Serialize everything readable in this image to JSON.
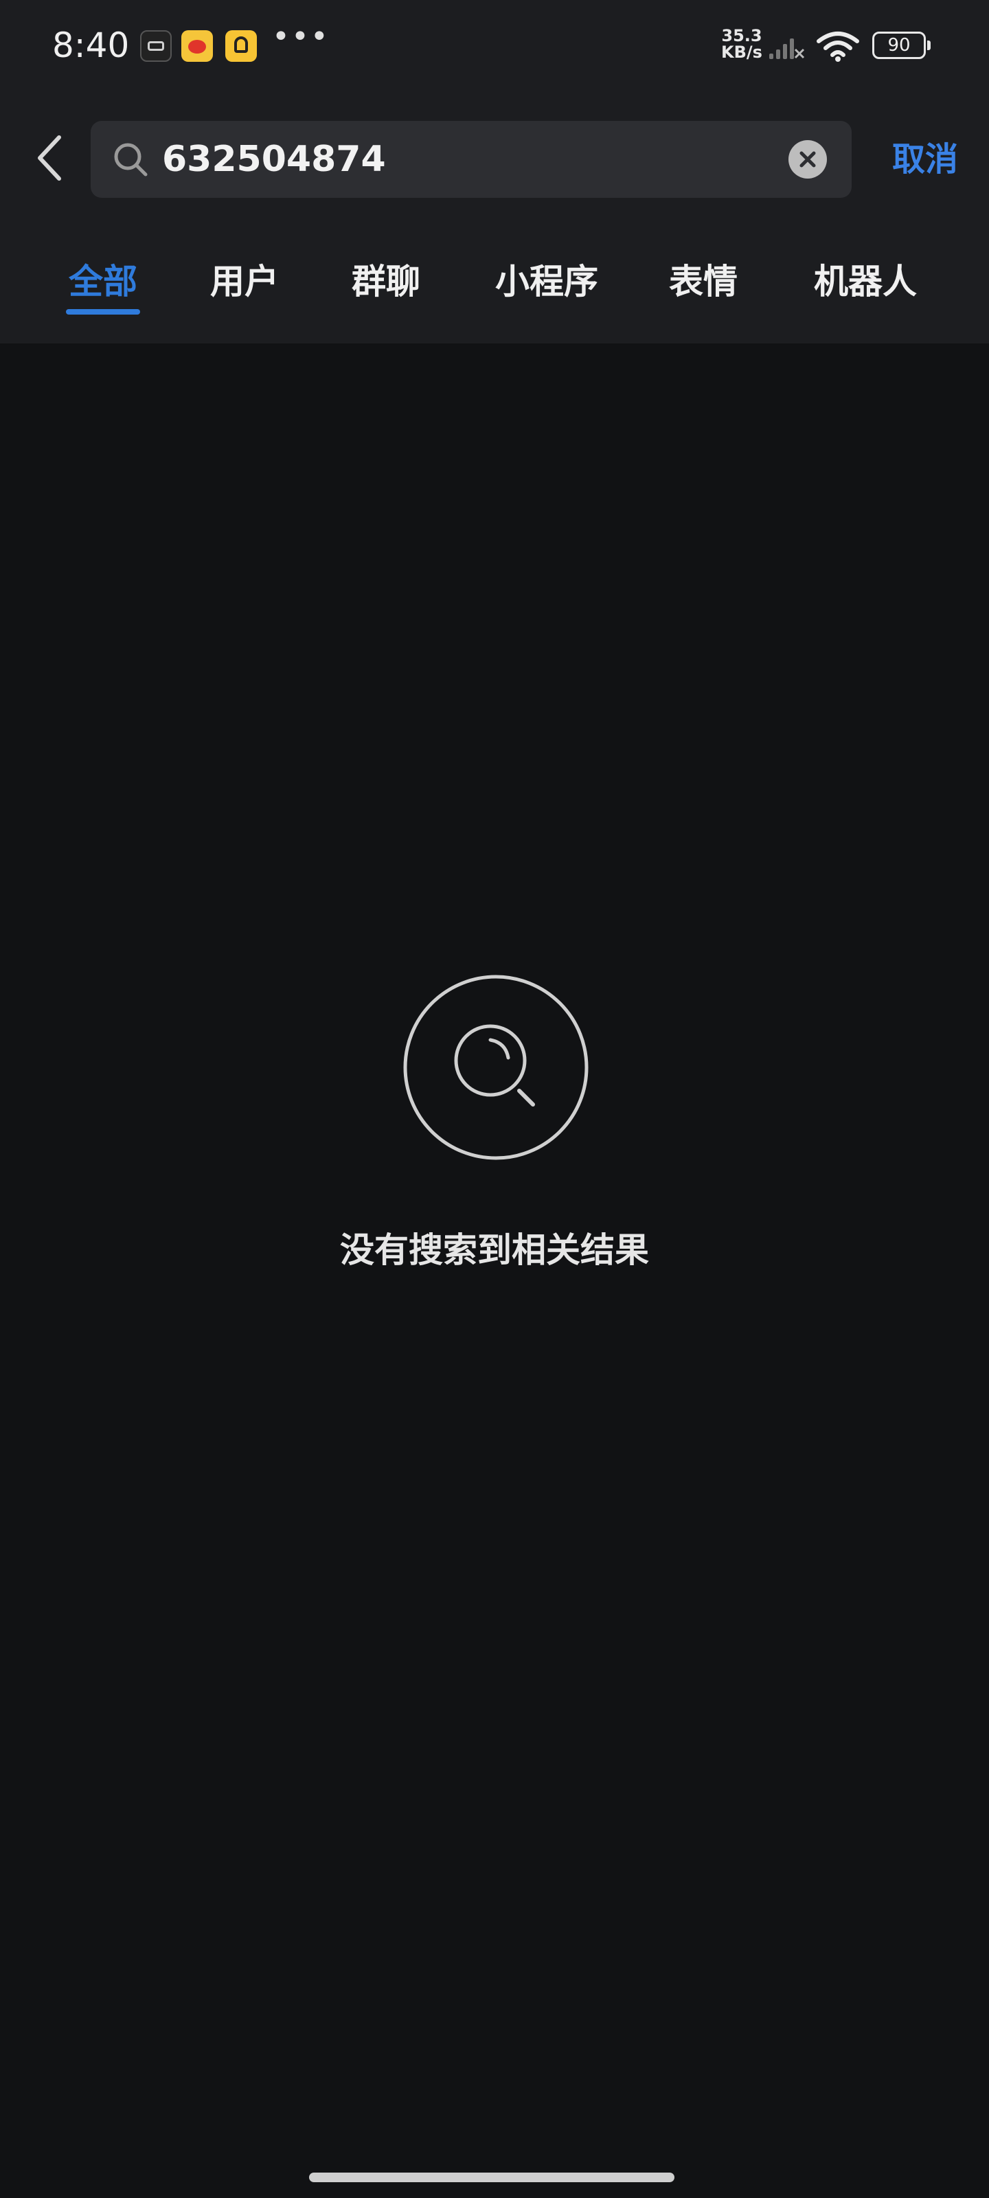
{
  "status_bar": {
    "time": "8:40",
    "net_speed_value": "35.3",
    "net_speed_unit": "KB/s",
    "battery": "90",
    "icons": [
      "gaming-app-icon",
      "weibo-icon",
      "app-icon",
      "more-dots-icon",
      "signal-icon",
      "wifi-icon",
      "battery-icon"
    ]
  },
  "search": {
    "value": "632504874",
    "cancel_label": "取消"
  },
  "tabs": [
    {
      "label": "全部",
      "active": true
    },
    {
      "label": "用户",
      "active": false
    },
    {
      "label": "群聊",
      "active": false
    },
    {
      "label": "小程序",
      "active": false
    },
    {
      "label": "表情",
      "active": false
    },
    {
      "label": "机器人",
      "active": false
    }
  ],
  "empty_state": {
    "message": "没有搜索到相关结果",
    "icon": "search-icon"
  },
  "colors": {
    "accent": "#2f7bdc",
    "background": "#111214",
    "header": "#1c1d20"
  }
}
